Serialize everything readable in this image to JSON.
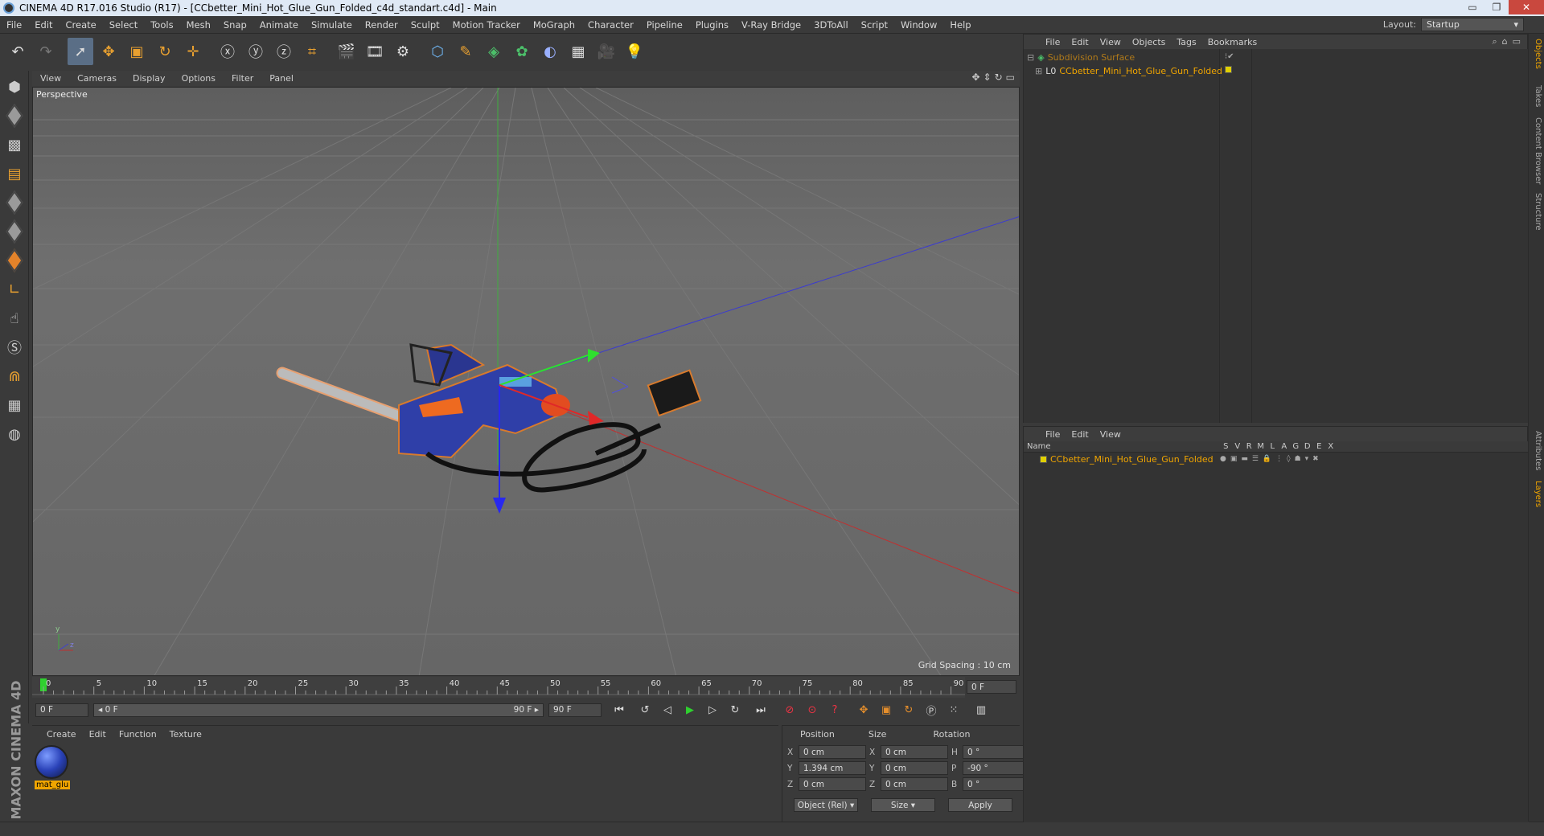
{
  "title_bar": {
    "text": "CINEMA 4D R17.016 Studio (R17) - [CCbetter_Mini_Hot_Glue_Gun_Folded_c4d_standart.c4d] - Main",
    "minimize": "▭",
    "maximize": "❐",
    "close": "✕"
  },
  "menu": [
    "File",
    "Edit",
    "Create",
    "Select",
    "Tools",
    "Mesh",
    "Snap",
    "Animate",
    "Simulate",
    "Render",
    "Sculpt",
    "Motion Tracker",
    "MoGraph",
    "Character",
    "Pipeline",
    "Plugins",
    "V-Ray Bridge",
    "3DToAll",
    "Script",
    "Window",
    "Help"
  ],
  "layout": {
    "label": "Layout:",
    "value": "Startup"
  },
  "viewport": {
    "menu": [
      "View",
      "Cameras",
      "Display",
      "Options",
      "Filter",
      "Panel"
    ],
    "camera": "Perspective",
    "grid_spacing": "Grid Spacing : 10 cm"
  },
  "timeline": {
    "ticks": [
      "0",
      "5",
      "10",
      "15",
      "20",
      "25",
      "30",
      "35",
      "40",
      "45",
      "50",
      "55",
      "60",
      "65",
      "70",
      "75",
      "80",
      "85",
      "90"
    ],
    "end_frame": "0 F"
  },
  "transport": {
    "start_field": "0 F",
    "range_start": "◂ 0 F",
    "range_end": "90 F ▸",
    "end_field": "90 F"
  },
  "material_manager": {
    "menu": [
      "Create",
      "Edit",
      "Function",
      "Texture"
    ],
    "materials": [
      {
        "name": "mat_glu"
      }
    ]
  },
  "coordinates": {
    "headers": [
      "Position",
      "Size",
      "Rotation"
    ],
    "rows": [
      {
        "axis": "X",
        "pos": "0 cm",
        "size_axis": "X",
        "size": "0 cm",
        "rot_axis": "H",
        "rot": "0 °"
      },
      {
        "axis": "Y",
        "pos": "1.394 cm",
        "size_axis": "Y",
        "size": "0 cm",
        "rot_axis": "P",
        "rot": "-90 °"
      },
      {
        "axis": "Z",
        "pos": "0 cm",
        "size_axis": "Z",
        "size": "0 cm",
        "rot_axis": "B",
        "rot": "0 °"
      }
    ],
    "mode": "Object (Rel)",
    "size_mode": "Size",
    "apply": "Apply"
  },
  "object_manager": {
    "menu": [
      "File",
      "Edit",
      "View",
      "Objects",
      "Tags",
      "Bookmarks"
    ],
    "objects": [
      {
        "name": "Subdivision Surface"
      },
      {
        "name": "CCbetter_Mini_Hot_Glue_Gun_Folded"
      }
    ]
  },
  "layer_manager": {
    "menu": [
      "File",
      "Edit",
      "View"
    ],
    "columns": [
      "Name",
      "S",
      "V",
      "R",
      "M",
      "L",
      "A",
      "G",
      "D",
      "E",
      "X"
    ],
    "layers": [
      {
        "name": "CCbetter_Mini_Hot_Glue_Gun_Folded"
      }
    ]
  },
  "side_tabs": [
    "Objects",
    "Takes",
    "Content Browser",
    "Structure",
    "Attributes",
    "Layers"
  ],
  "brand": "MAXON CINEMA 4D",
  "colors": {
    "accent": "#f0a500",
    "active_tool": "#5a6e86"
  }
}
